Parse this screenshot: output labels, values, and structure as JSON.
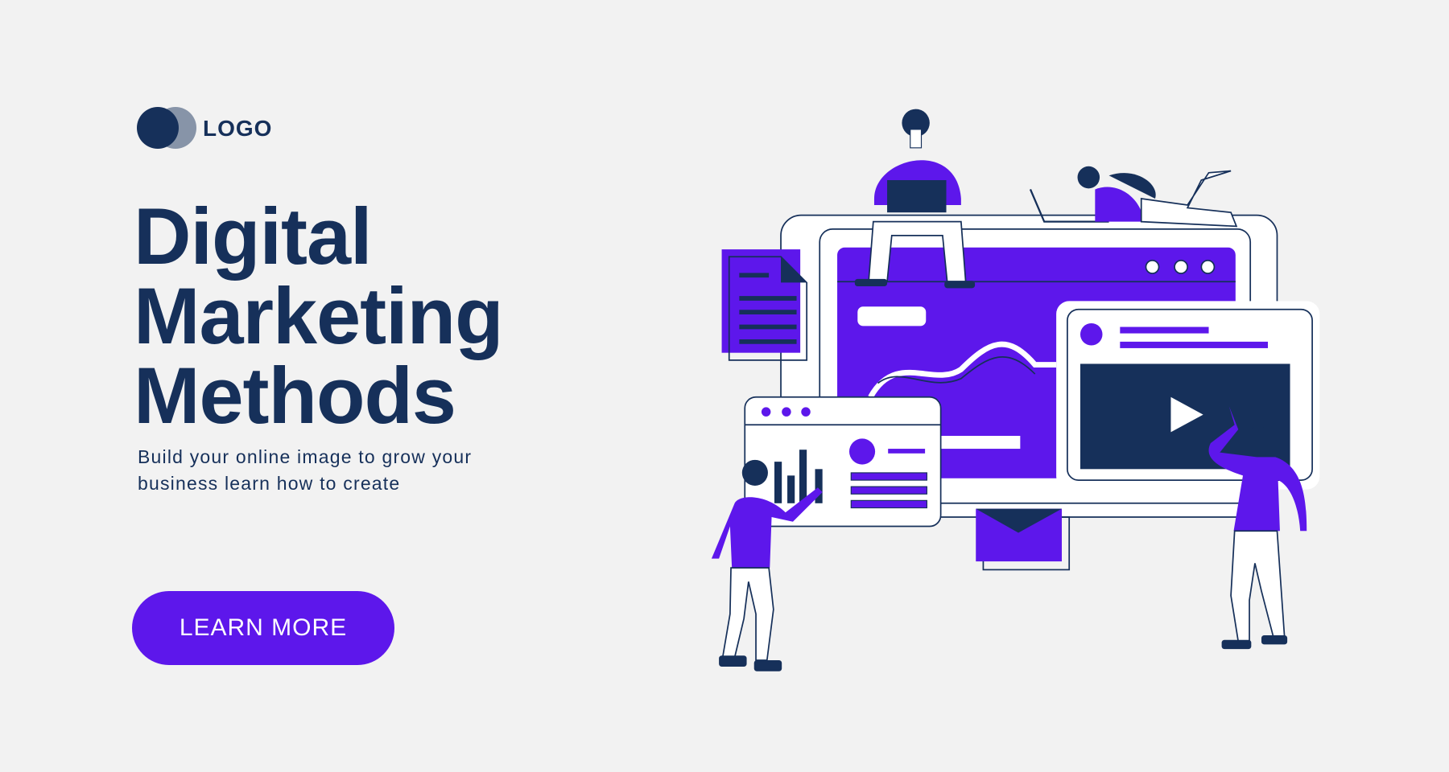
{
  "logo": {
    "text": "LOGO"
  },
  "hero": {
    "title_lines": [
      "Digital",
      "Marketing",
      "Methods"
    ],
    "subtitle_lines": [
      "Build your online image to grow your",
      "business learn how to create"
    ],
    "cta_label": "LEARN MORE"
  },
  "colors": {
    "background": "#f2f2f2",
    "navy": "#16305a",
    "purple": "#5d17eb",
    "logo_grey": "#8794a8"
  }
}
